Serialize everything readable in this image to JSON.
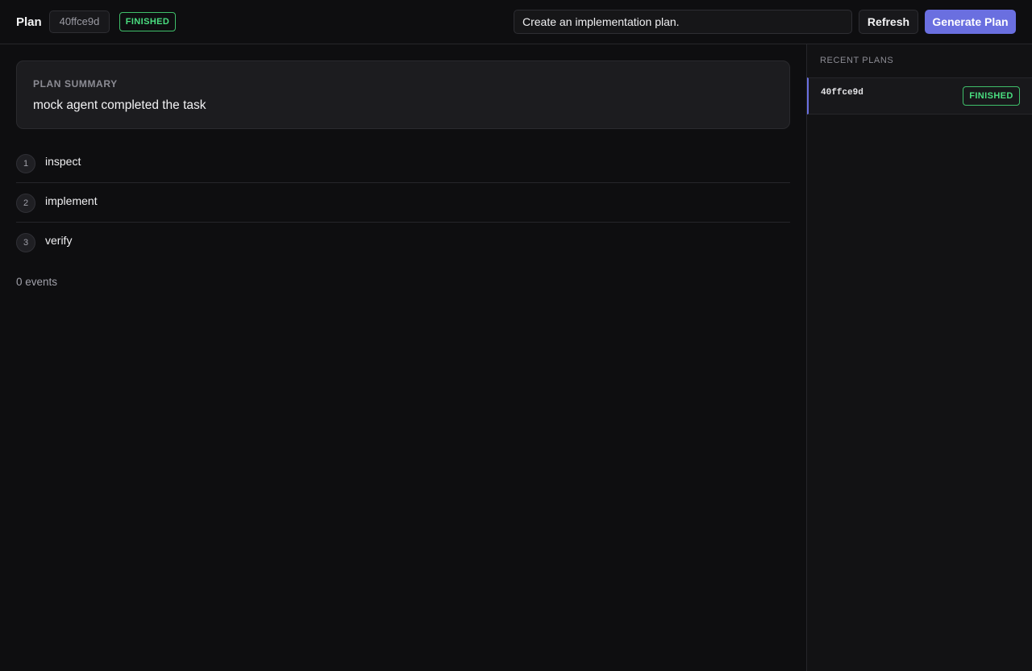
{
  "header": {
    "title": "Plan",
    "plan_id": "40ffce9d",
    "status": "FINISHED",
    "prompt_value": "Create an implementation plan.",
    "refresh_label": "Refresh",
    "generate_label": "Generate Plan"
  },
  "summary": {
    "label": "PLAN SUMMARY",
    "text": "mock agent completed the task"
  },
  "steps": [
    {
      "number": "1",
      "label": "inspect"
    },
    {
      "number": "2",
      "label": "implement"
    },
    {
      "number": "3",
      "label": "verify"
    }
  ],
  "events": {
    "count_text": "0 events"
  },
  "sidebar": {
    "title": "RECENT PLANS",
    "items": [
      {
        "id": "40ffce9d",
        "status": "FINISHED"
      }
    ]
  },
  "colors": {
    "accent": "#6a6fe0",
    "success": "#4ade80",
    "background": "#0e0e10"
  }
}
